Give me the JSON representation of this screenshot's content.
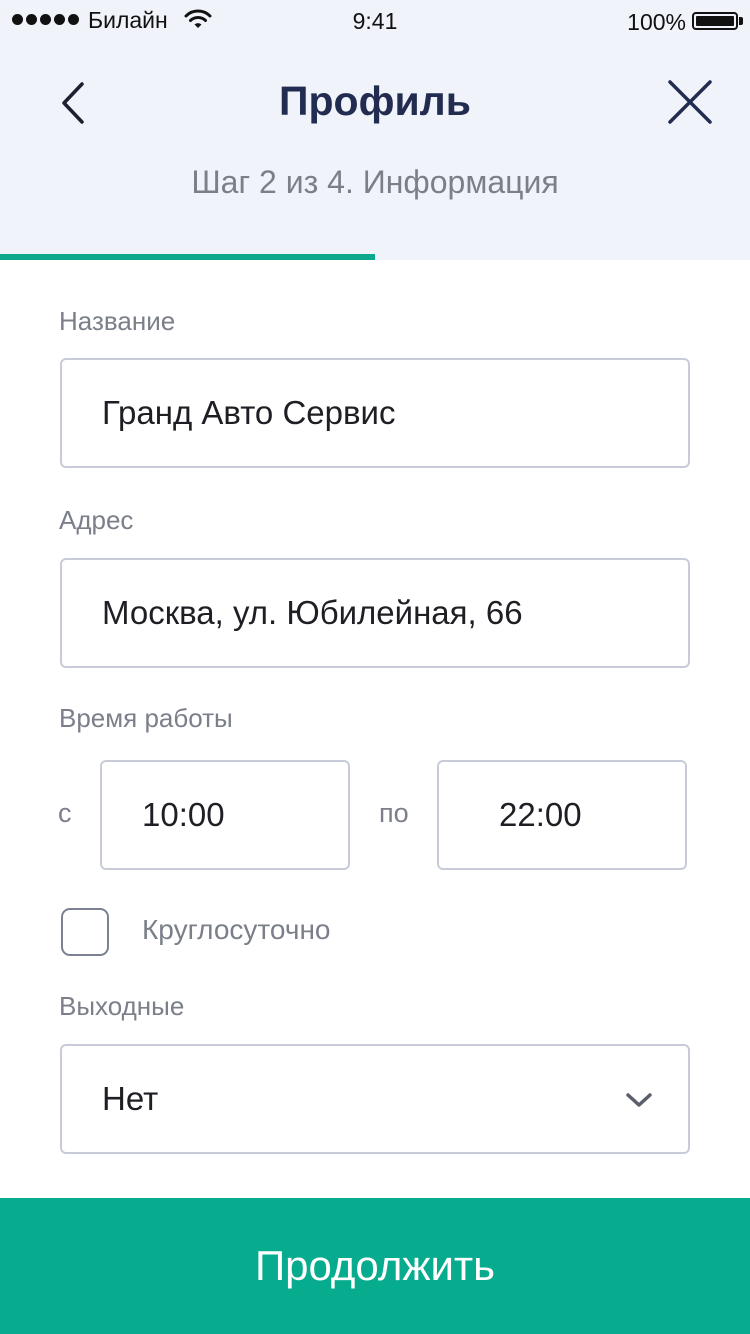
{
  "status_bar": {
    "carrier": "Билайн",
    "time": "9:41",
    "battery_percent": "100%",
    "signal_bars": 5
  },
  "header": {
    "title": "Профиль",
    "step": "Шаг 2 из 4. Информация",
    "progress": 0.5,
    "back_icon": "chevron-left-icon",
    "close_icon": "close-icon"
  },
  "form": {
    "name": {
      "label": "Название",
      "value": "Гранд Авто Сервис"
    },
    "address": {
      "label": "Адрес",
      "value": "Москва, ул. Юбилейная, 66"
    },
    "hours": {
      "label": "Время работы",
      "from_label": "с",
      "from_value": "10:00",
      "to_label": "по",
      "to_value": "22:00"
    },
    "round_the_clock": {
      "label": "Круглосуточно",
      "checked": false
    },
    "days_off": {
      "label": "Выходные",
      "value": "Нет"
    }
  },
  "continue_button": {
    "label": "Продолжить"
  },
  "colors": {
    "accent": "#07ab8e",
    "title": "#222b50",
    "header_bg": "#f0f3f9",
    "muted_text": "#7b7f8a",
    "field_border": "#c7ccd8"
  }
}
